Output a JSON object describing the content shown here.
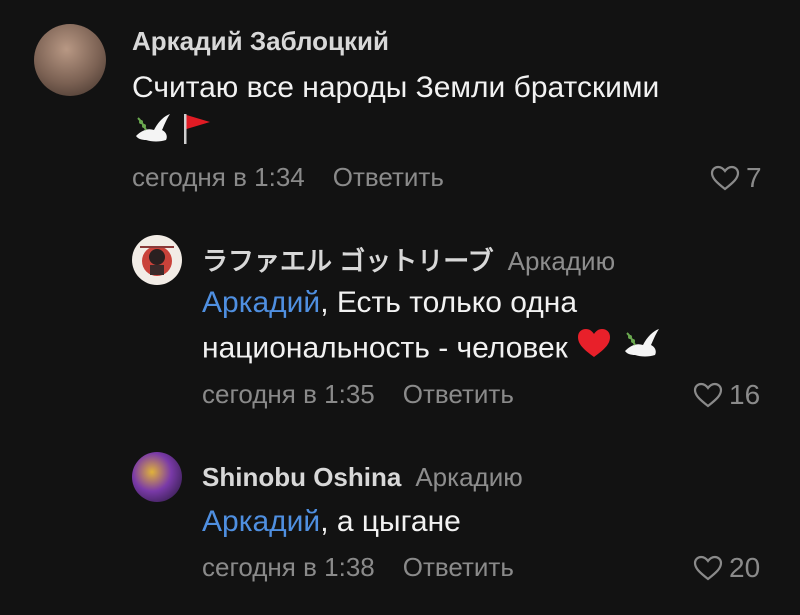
{
  "comments": [
    {
      "author": "Аркадий Заблоцкий",
      "text_line1": "Считаю все народы Земли братскими",
      "emojis": [
        "dove-icon",
        "red-flag-icon"
      ],
      "time": "сегодня в 1:34",
      "reply_label": "Ответить",
      "likes": "7"
    },
    {
      "author": "ラファエル ゴットリーブ",
      "reply_to": "Аркадию",
      "mention": "Аркадий",
      "text_after_mention": ", Есть только одна",
      "text_line2": "национальность - человек",
      "emojis": [
        "red-heart-icon",
        "dove-icon"
      ],
      "time": "сегодня в 1:35",
      "reply_label": "Ответить",
      "likes": "16"
    },
    {
      "author": "Shinobu Oshina",
      "reply_to": "Аркадию",
      "mention": "Аркадий",
      "text_after_mention": ", а цыгане",
      "time": "сегодня в 1:38",
      "reply_label": "Ответить",
      "likes": "20"
    }
  ],
  "colors": {
    "background": "#121212",
    "mention": "#4f8fe0",
    "muted": "#8a8a8a",
    "heart": "#e8202a"
  }
}
